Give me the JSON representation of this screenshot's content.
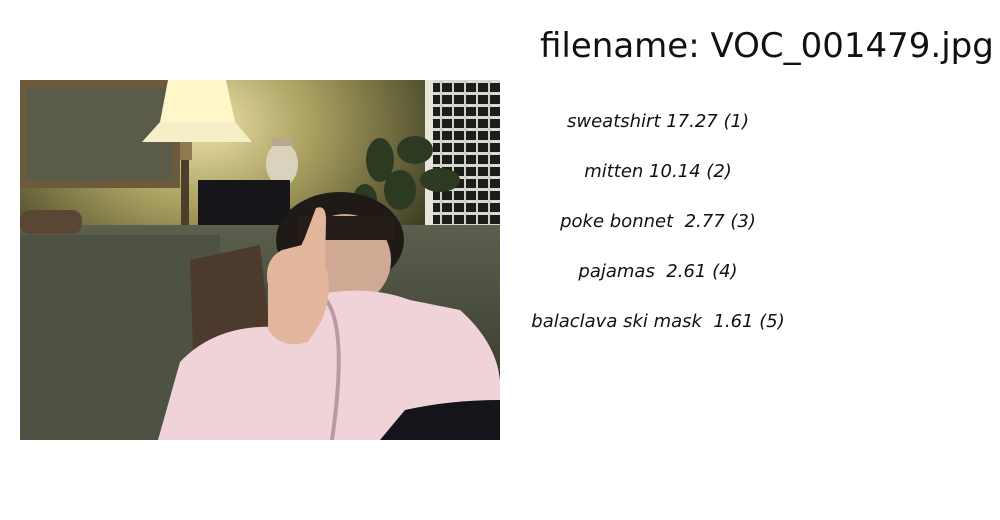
{
  "header": {
    "title": "filename: VOC_001479.jpg"
  },
  "image": {
    "alt": "photo"
  },
  "predictions": [
    {
      "text": "sweatshirt 17.27 (1)"
    },
    {
      "text": "mitten 10.14 (2)"
    },
    {
      "text": "poke bonnet  2.77 (3)"
    },
    {
      "text": "pajamas  2.61 (4)"
    },
    {
      "text": "balaclava ski mask  1.61 (5)"
    }
  ]
}
